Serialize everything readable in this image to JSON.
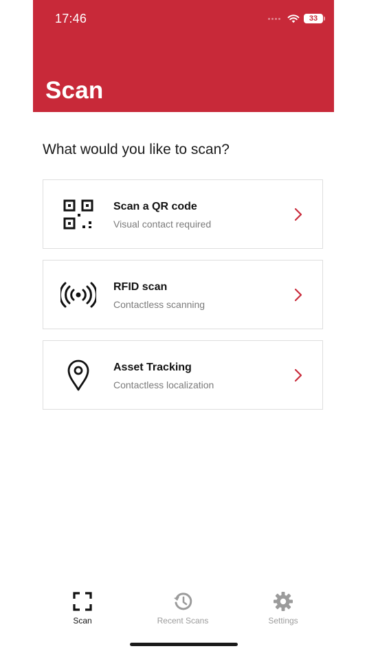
{
  "status_bar": {
    "time": "17:46",
    "battery": "33",
    "icons": [
      "cellular-signal-icon",
      "wifi-icon",
      "battery-icon"
    ]
  },
  "header": {
    "title": "Scan"
  },
  "main": {
    "prompt": "What would you like to scan?",
    "options": [
      {
        "title": "Scan a QR code",
        "subtitle": "Visual contact required",
        "icon": "qr-code-icon"
      },
      {
        "title": "RFID scan",
        "subtitle": "Contactless scanning",
        "icon": "rfid-icon"
      },
      {
        "title": "Asset Tracking",
        "subtitle": "Contactless localization",
        "icon": "location-pin-icon"
      }
    ]
  },
  "tabbar": {
    "tabs": [
      {
        "label": "Scan",
        "icon": "scan-frame-icon",
        "active": true
      },
      {
        "label": "Recent Scans",
        "icon": "history-icon",
        "active": false
      },
      {
        "label": "Settings",
        "icon": "gear-icon",
        "active": false
      }
    ]
  },
  "colors": {
    "brand": "#c82939",
    "chevron": "#c82939",
    "inactive_tab": "#9b9b9b",
    "active_tab": "#111111",
    "card_border": "#dedede"
  }
}
